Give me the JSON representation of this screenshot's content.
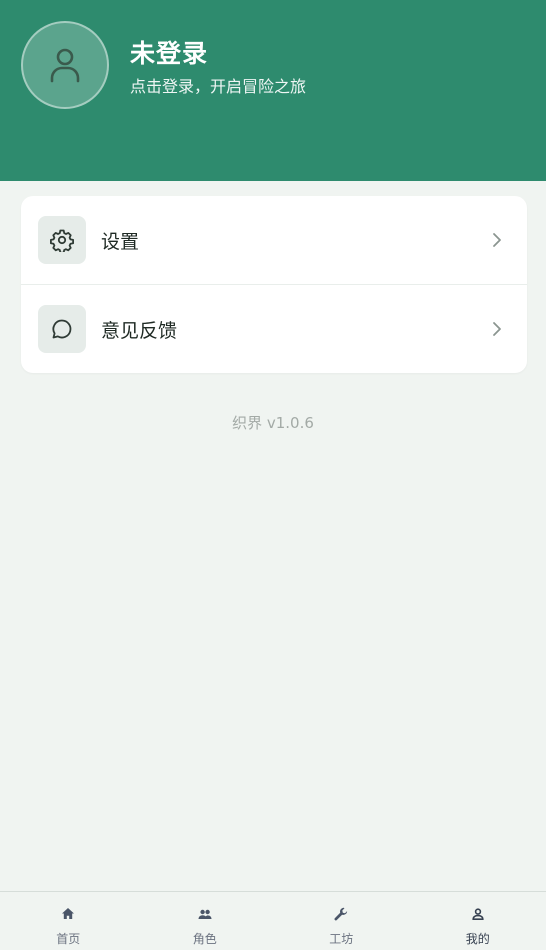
{
  "header": {
    "title": "未登录",
    "subtitle": "点击登录，开启冒险之旅",
    "avatar_icon": "user-icon",
    "bg_color": "#2e8b6e"
  },
  "menu": {
    "items": [
      {
        "label": "设置",
        "icon": "gear-icon"
      },
      {
        "label": "意见反馈",
        "icon": "chat-bubble-icon"
      }
    ]
  },
  "version": "织界 v1.0.6",
  "bottom_nav": {
    "items": [
      {
        "label": "首页",
        "icon": "home-icon"
      },
      {
        "label": "角色",
        "icon": "people-icon"
      },
      {
        "label": "工坊",
        "icon": "wrench-icon"
      },
      {
        "label": "我的",
        "icon": "person-icon",
        "active": true
      }
    ]
  }
}
